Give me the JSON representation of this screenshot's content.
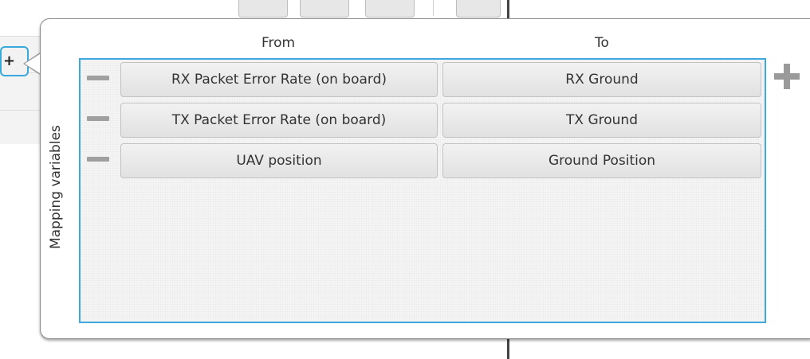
{
  "popover": {
    "trigger_glyph": "+",
    "section_label": "Mapping variables",
    "headers": {
      "from": "From",
      "to": "To"
    },
    "rows": [
      {
        "from": "RX Packet Error Rate (on board)",
        "to": "RX Ground"
      },
      {
        "from": "TX Packet Error Rate (on board)",
        "to": "TX Ground"
      },
      {
        "from": "UAV position",
        "to": "Ground Position"
      }
    ],
    "add_icon": "plus-icon",
    "remove_icon": "minus-icon"
  },
  "colors": {
    "accent": "#3fa9dd",
    "icon_gray": "#9a9a9a",
    "button_bg": "#e8e8e8"
  }
}
